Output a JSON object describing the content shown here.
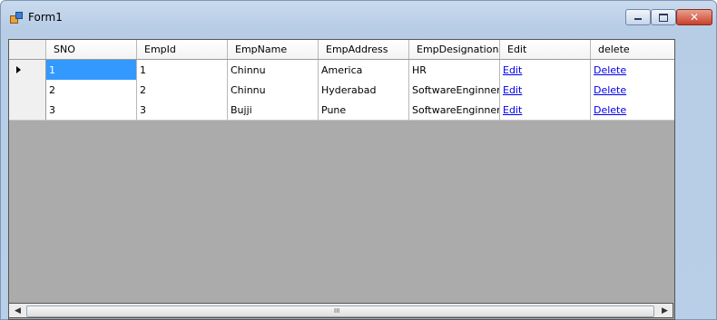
{
  "window": {
    "title": "Form1"
  },
  "grid": {
    "columns": [
      "SNO",
      "EmpId",
      "EmpName",
      "EmpAddress",
      "EmpDesignation",
      "Edit",
      "delete"
    ],
    "rows": [
      {
        "sno": "1",
        "empid": "1",
        "name": "Chinnu",
        "address": "America",
        "designation": "HR",
        "edit": "Edit",
        "delete": "Delete",
        "current": true,
        "selected_column": "SNO"
      },
      {
        "sno": "2",
        "empid": "2",
        "name": "Chinnu",
        "address": "Hyderabad",
        "designation": "SoftwareEnginner",
        "edit": "Edit",
        "delete": "Delete"
      },
      {
        "sno": "3",
        "empid": "3",
        "name": "Bujji",
        "address": "Pune",
        "designation": "SoftwareEnginner",
        "edit": "Edit",
        "delete": "Delete"
      }
    ]
  },
  "scrollbar": {
    "grip": "III"
  },
  "colors": {
    "selection": "#3399ff",
    "grid_background": "#ababab",
    "link": "#0000ee"
  }
}
